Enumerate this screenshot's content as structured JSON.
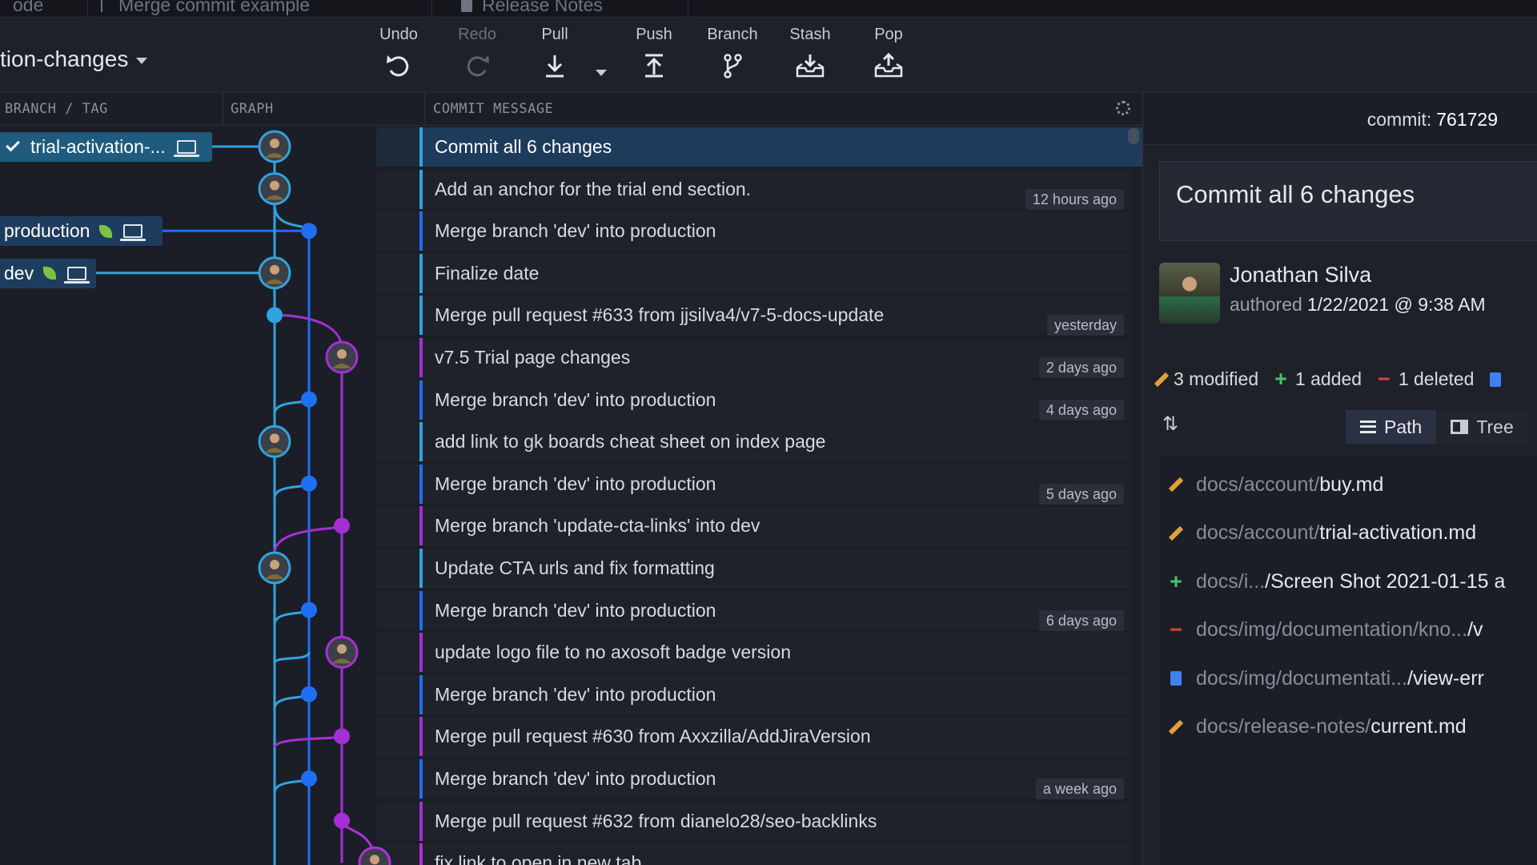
{
  "tabs": [
    {
      "label": "ode"
    },
    {
      "label": "Merge commit example"
    },
    {
      "label": "Release Notes"
    }
  ],
  "repo": {
    "branch_name": "tion-changes"
  },
  "toolbar": {
    "undo": "Undo",
    "redo": "Redo",
    "pull": "Pull",
    "push": "Push",
    "branch": "Branch",
    "stash": "Stash",
    "pop": "Pop"
  },
  "columns": {
    "branch_tag": "BRANCH / TAG",
    "graph": "GRAPH",
    "commit_message": "COMMIT MESSAGE"
  },
  "branches": [
    {
      "name": "trial-activation-...",
      "row": 0,
      "checked": true,
      "leaf": false
    },
    {
      "name": "production",
      "row": 2,
      "checked": false,
      "leaf": true
    },
    {
      "name": "dev",
      "row": 3,
      "checked": false,
      "leaf": true
    }
  ],
  "commits": [
    {
      "message": "Commit all 6 changes",
      "lane": 0,
      "node": "avatar",
      "selected": true
    },
    {
      "message": "Add an anchor for the trial end section.",
      "lane": 0,
      "node": "avatar",
      "time": "12 hours ago"
    },
    {
      "message": "Merge branch 'dev' into production",
      "lane": 1,
      "node": "dot"
    },
    {
      "message": "Finalize date",
      "lane": 0,
      "node": "avatar"
    },
    {
      "message": "Merge pull request #633 from jjsilva4/v7-5-docs-update",
      "lane": 0,
      "node": "dot",
      "time": "yesterday"
    },
    {
      "message": "v7.5 Trial page changes",
      "lane": 2,
      "node": "avatar",
      "time": "2 days ago"
    },
    {
      "message": "Merge branch 'dev' into production",
      "lane": 1,
      "node": "dot",
      "time": "4 days ago"
    },
    {
      "message": "add link to gk boards cheat sheet on index page",
      "lane": 0,
      "node": "avatar"
    },
    {
      "message": "Merge branch 'dev' into production",
      "lane": 1,
      "node": "dot",
      "time": "5 days ago"
    },
    {
      "message": "Merge branch 'update-cta-links' into dev",
      "lane": 2,
      "node": "dot"
    },
    {
      "message": "Update CTA urls and fix formatting",
      "lane": 0,
      "node": "avatar"
    },
    {
      "message": "Merge branch 'dev' into production",
      "lane": 1,
      "node": "dot",
      "time": "6 days ago"
    },
    {
      "message": "update logo file to no axosoft badge version",
      "lane": 2,
      "node": "avatar"
    },
    {
      "message": "Merge branch 'dev' into production",
      "lane": 1,
      "node": "dot"
    },
    {
      "message": "Merge pull request #630 from Axxzilla/AddJiraVersion",
      "lane": 2,
      "node": "dot"
    },
    {
      "message": "Merge branch 'dev' into production",
      "lane": 1,
      "node": "dot",
      "time": "a week ago"
    },
    {
      "message": "Merge pull request #632 from dianelo28/seo-backlinks",
      "lane": 2,
      "node": "dot"
    },
    {
      "message": "fix link to open in new tab",
      "lane": 3,
      "node": "avatar"
    }
  ],
  "colors": {
    "lane0": "#2fa3e0",
    "lane1": "#1f6ff2",
    "lane2": "#a52fd6",
    "lane3": "#b030d8",
    "selected": "#1f3b5c"
  },
  "detail": {
    "commit_label": "commit:",
    "commit_id": "761729",
    "summary": "Commit all 6 changes",
    "author": "Jonathan Silva",
    "authored_label": "authored",
    "authored_date": "1/22/2021 @ 9:38 AM",
    "stats": {
      "modified": "3 modified",
      "added": "1 added",
      "deleted": "1 deleted"
    },
    "view_path": "Path",
    "view_tree": "Tree",
    "files": [
      {
        "status": "modified",
        "path": "docs/account/",
        "name": "buy.md"
      },
      {
        "status": "modified",
        "path": "docs/account/",
        "name": "trial-activation.md"
      },
      {
        "status": "added",
        "path": "docs/i...  ",
        "name": "/Screen Shot 2021-01-15 a"
      },
      {
        "status": "deleted",
        "path": "docs/img/documentation/kno...  ",
        "name": "/v"
      },
      {
        "status": "renamed",
        "path": "docs/img/documentati...  ",
        "name": "/view-err"
      },
      {
        "status": "modified",
        "path": "docs/release-notes/",
        "name": "current.md"
      }
    ]
  }
}
